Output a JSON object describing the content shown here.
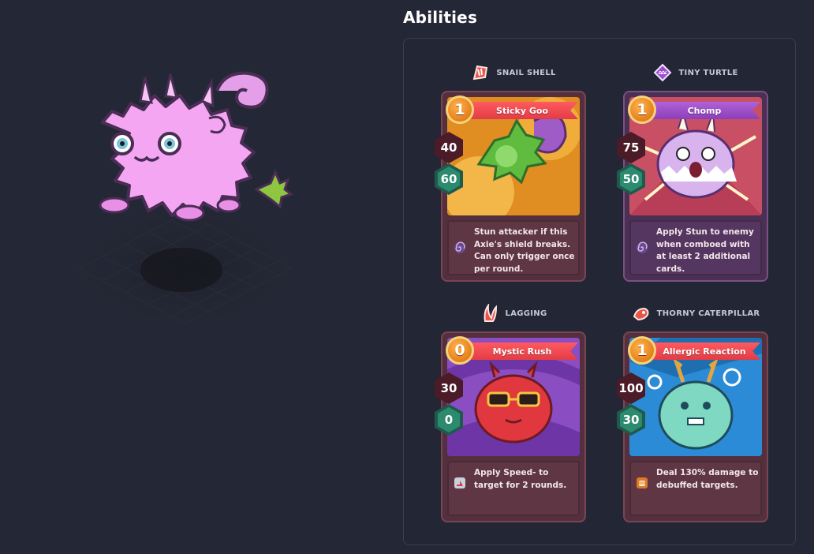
{
  "abilities": {
    "title": "Abilities",
    "cards": [
      {
        "part_name": "SNAIL SHELL",
        "part_icon": "back-part-icon",
        "card_name": "Sticky Goo",
        "energy": "1",
        "attack": "40",
        "shield": "60",
        "description": "Stun attacker if this Axie's shield breaks. Can only trigger once per round.",
        "effect_icon": "stun-spiral-icon"
      },
      {
        "part_name": "TINY TURTLE",
        "part_icon": "mouth-part-icon",
        "card_name": "Chomp",
        "energy": "1",
        "attack": "75",
        "shield": "50",
        "description": "Apply Stun to enemy when comboed with at least 2 additional cards.",
        "effect_icon": "stun-spiral-icon"
      },
      {
        "part_name": "LAGGING",
        "part_icon": "horn-part-icon",
        "card_name": "Mystic Rush",
        "energy": "0",
        "attack": "30",
        "shield": "0",
        "description": "Apply Speed- to target for 2 rounds.",
        "effect_icon": "speed-down-icon"
      },
      {
        "part_name": "THORNY CATERPILLAR",
        "part_icon": "tail-part-icon",
        "card_name": "Allergic Reaction",
        "energy": "1",
        "attack": "100",
        "shield": "30",
        "description": "Deal 130% damage to debuffed targets.",
        "effect_icon": "fist-icon"
      }
    ]
  },
  "colors": {
    "background": "#242735",
    "axie_body": "#f4a6f3",
    "card_red_banner": "#e23c46",
    "card_purple_banner": "#8c3fb8"
  }
}
